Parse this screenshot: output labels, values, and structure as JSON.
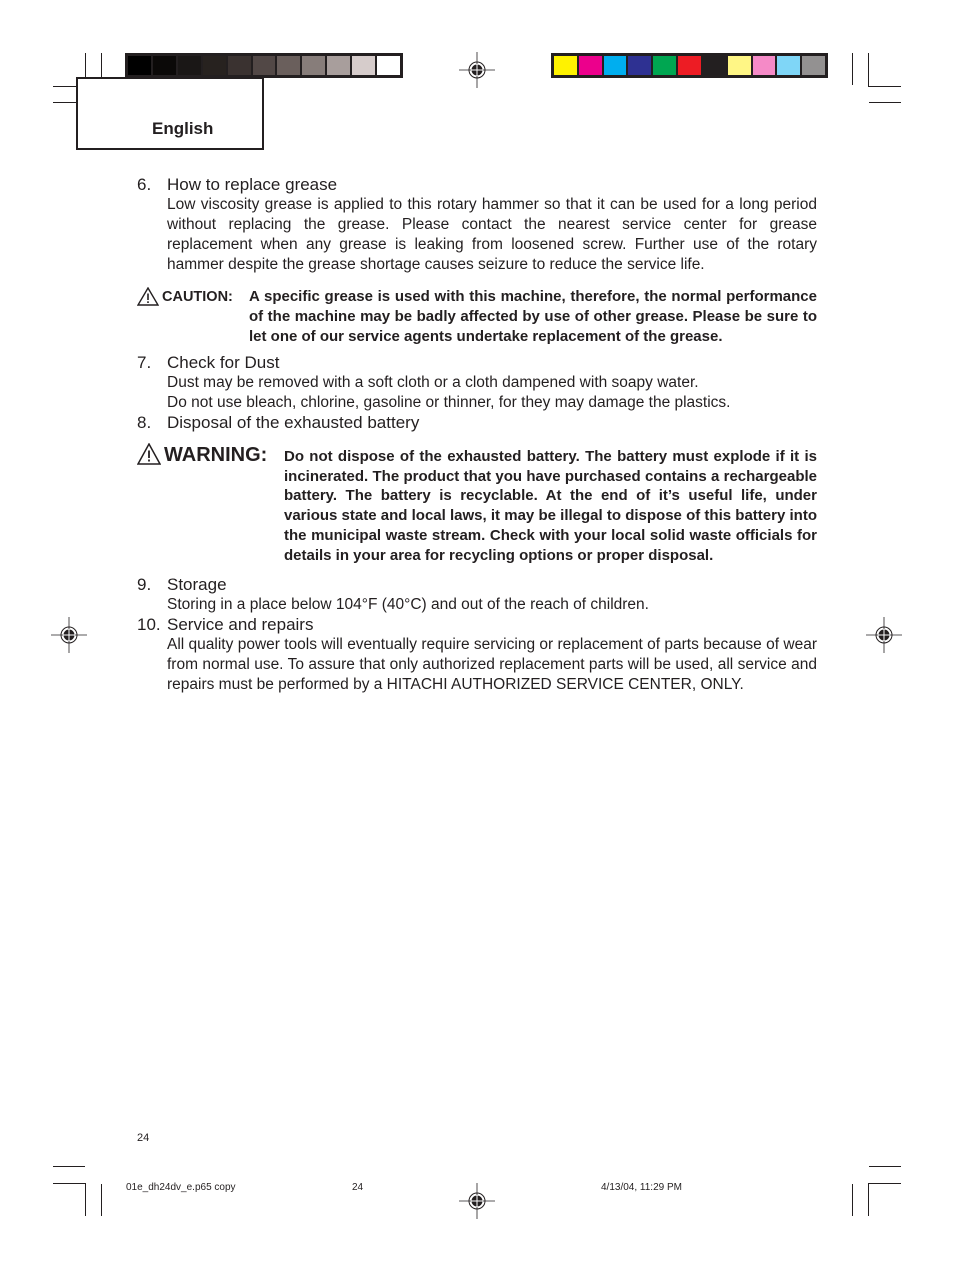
{
  "color_bars": {
    "grayscale": [
      "#000000",
      "#0b0908",
      "#1a1716",
      "#27221f",
      "#3a3230",
      "#524846",
      "#6a5f5c",
      "#877d7a",
      "#a89e9c",
      "#d6cccb",
      "#ffffff"
    ],
    "process": [
      "#fff200",
      "#ec008c",
      "#00aeef",
      "#2e3192",
      "#00a651",
      "#ed1c24",
      "#231f20",
      "#fff685",
      "#f58ac7",
      "#7fd6f7",
      "#939191"
    ]
  },
  "header": {
    "language": "English"
  },
  "icons": {
    "caution": "warning-triangle-icon",
    "warning": "warning-triangle-icon",
    "registration": "registration-mark-icon"
  },
  "sections": [
    {
      "num": "6.",
      "title": "How to replace grease",
      "paragraphs": [
        "Low viscosity grease is applied to this rotary hammer so that it can be used for a long period without replacing the grease. Please contact the nearest service center for grease replacement when any grease is leaking from loosened screw. Further use of the rotary hammer despite the grease shortage causes seizure to reduce the service life."
      ]
    },
    {
      "num": "7.",
      "title": "Check for Dust",
      "paragraphs": [
        "Dust may be removed with a soft cloth or a cloth dampened with soapy water.",
        "Do not use bleach, chlorine, gasoline or thinner, for they may damage the plastics."
      ]
    },
    {
      "num": "8.",
      "title": "Disposal of the exhausted battery"
    },
    {
      "num": "9.",
      "title": "Storage",
      "paragraphs": [
        "Storing in a place below 104°F (40°C) and out of the reach of children."
      ]
    },
    {
      "num": "10.",
      "title": "Service and repairs",
      "paragraphs": [
        "All quality power tools will eventually require servicing or replacement of parts because of wear from normal use. To assure that only authorized replacement parts will be used, all service and repairs must be performed by a HITACHI AUTHORIZED SERVICE CENTER, ONLY."
      ]
    }
  ],
  "caution": {
    "label": "CAUTION:",
    "text": "A specific grease is used with this machine, therefore, the normal performance of the machine may be badly affected by use of other grease. Please be sure to let one of our service agents undertake replacement of the grease."
  },
  "warning": {
    "label": "WARNING:",
    "text": "Do not dispose of the exhausted battery. The battery must explode if it is incinerated. The product that you have purchased contains a rechargeable battery. The battery is recyclable. At the end of it’s useful life, under various state and local laws, it may be illegal to dispose of this battery into the municipal waste stream. Check with your local solid waste officials for details in your area for recycling options or proper disposal."
  },
  "footer": {
    "page_number": "24",
    "slug_filename": "01e_dh24dv_e.p65 copy",
    "slug_page": "24",
    "slug_timestamp": "4/13/04, 11:29 PM"
  }
}
